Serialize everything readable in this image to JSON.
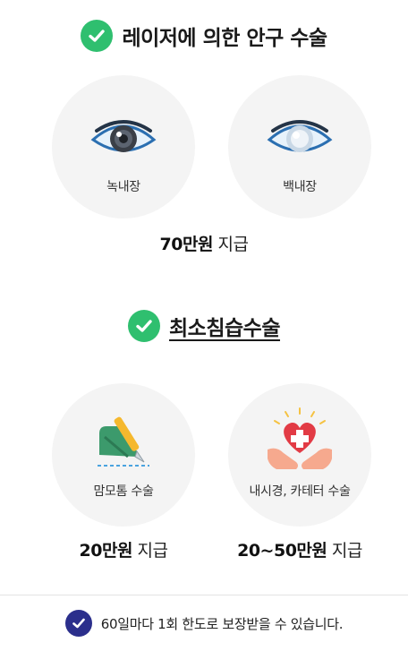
{
  "section1": {
    "title": "레이저에 의한 안구 수술",
    "items": [
      {
        "label": "녹내장",
        "icon": "dark-eye-icon"
      },
      {
        "label": "백내장",
        "icon": "cloudy-eye-icon"
      }
    ],
    "amount_bold": "70만원",
    "amount_suffix": " 지급"
  },
  "section2": {
    "title": "최소침습수술",
    "items": [
      {
        "label": "맘모톰 수술",
        "icon": "scalpel-icon",
        "amount_bold": "20만원",
        "amount_suffix": " 지급"
      },
      {
        "label": "내시경, 카테터 수술",
        "icon": "heart-in-hands-icon",
        "amount_bold": "20~50만원",
        "amount_suffix": " 지급"
      }
    ]
  },
  "footer": {
    "text": "60일마다 1회 한도로 보장받을 수 있습니다."
  },
  "colors": {
    "check_green": "#2fbf6f",
    "footer_navy": "#2b2f8c",
    "circle_bg": "#f4f4f4"
  }
}
